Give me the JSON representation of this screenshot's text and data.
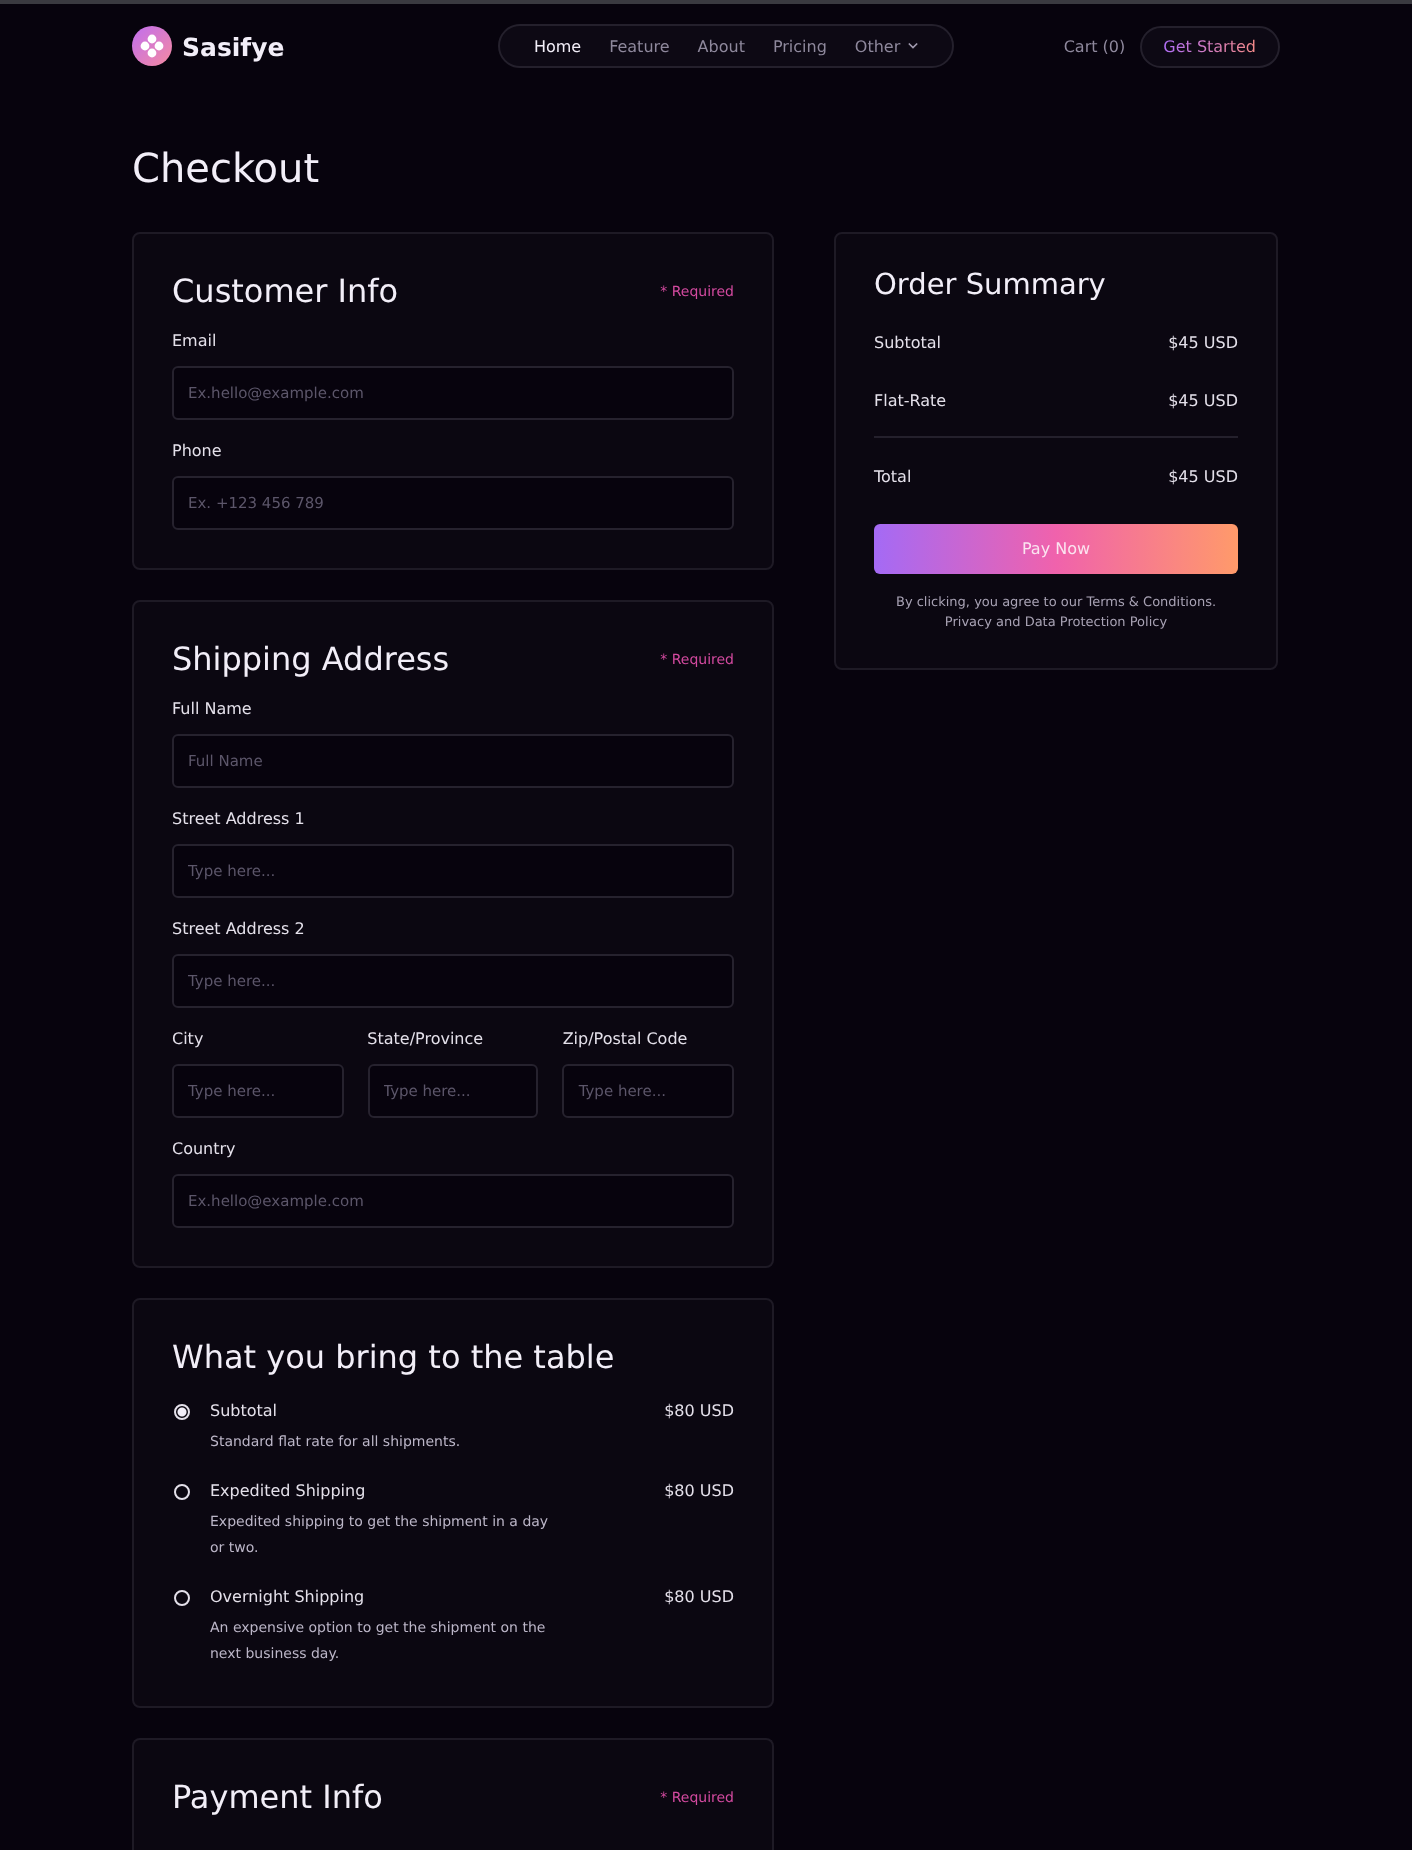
{
  "header": {
    "brand": "Sasifye",
    "nav": [
      {
        "label": "Home",
        "selected": true
      },
      {
        "label": "Feature",
        "selected": false
      },
      {
        "label": "About",
        "selected": false
      },
      {
        "label": "Pricing",
        "selected": false
      },
      {
        "label": "Other",
        "selected": false,
        "kind": "dropdown"
      }
    ],
    "cart": "Cart (0)",
    "cta": "Get Started"
  },
  "page_title": "Checkout",
  "customer_info": {
    "title": "Customer Info",
    "required": "* Required",
    "rows": [
      [
        {
          "label": "Email",
          "placeholder": "Ex.hello@example.com"
        }
      ],
      [
        {
          "label": "Phone",
          "placeholder": "Ex. +123 456 789"
        }
      ]
    ]
  },
  "shipping_address": {
    "title": "Shipping Address",
    "required": "* Required",
    "rows": [
      [
        {
          "label": "Full Name",
          "placeholder": "Full Name"
        }
      ],
      [
        {
          "label": "Street Address 1",
          "placeholder": "Type here..."
        }
      ],
      [
        {
          "label": "Street Address 2",
          "placeholder": "Type here..."
        }
      ],
      [
        {
          "label": "City",
          "placeholder": "Type here..."
        },
        {
          "label": "State/Province",
          "placeholder": "Type here..."
        },
        {
          "label": "Zip/Postal Code",
          "placeholder": "Type here..."
        }
      ],
      [
        {
          "label": "Country",
          "placeholder": "Ex.hello@example.com"
        }
      ]
    ]
  },
  "shipping_options": {
    "title": "What you bring to the table",
    "options": [
      {
        "title": "Subtotal",
        "description": "Standard flat rate for all shipments.",
        "price": "$80 USD",
        "selected": true
      },
      {
        "title": "Expedited Shipping",
        "description": "Expedited shipping to get the shipment in a day or two.",
        "price": "$80 USD",
        "selected": false
      },
      {
        "title": "Overnight Shipping",
        "description": "An expensive option to get the shipment on the next business day.",
        "price": "$80 USD",
        "selected": false
      }
    ]
  },
  "payment_info": {
    "title": "Payment Info",
    "required": "* Required"
  },
  "order_summary": {
    "title": "Order Summary",
    "lines": [
      {
        "label": "Subtotal",
        "value": "$45 USD"
      },
      {
        "label": "Flat-Rate",
        "value": "$45 USD"
      }
    ],
    "total": {
      "label": "Total",
      "value": "$45 USD"
    },
    "button": "Pay Now",
    "note": "By clicking, you agree to our Terms & Conditions. Privacy and Data Protection Policy"
  }
}
